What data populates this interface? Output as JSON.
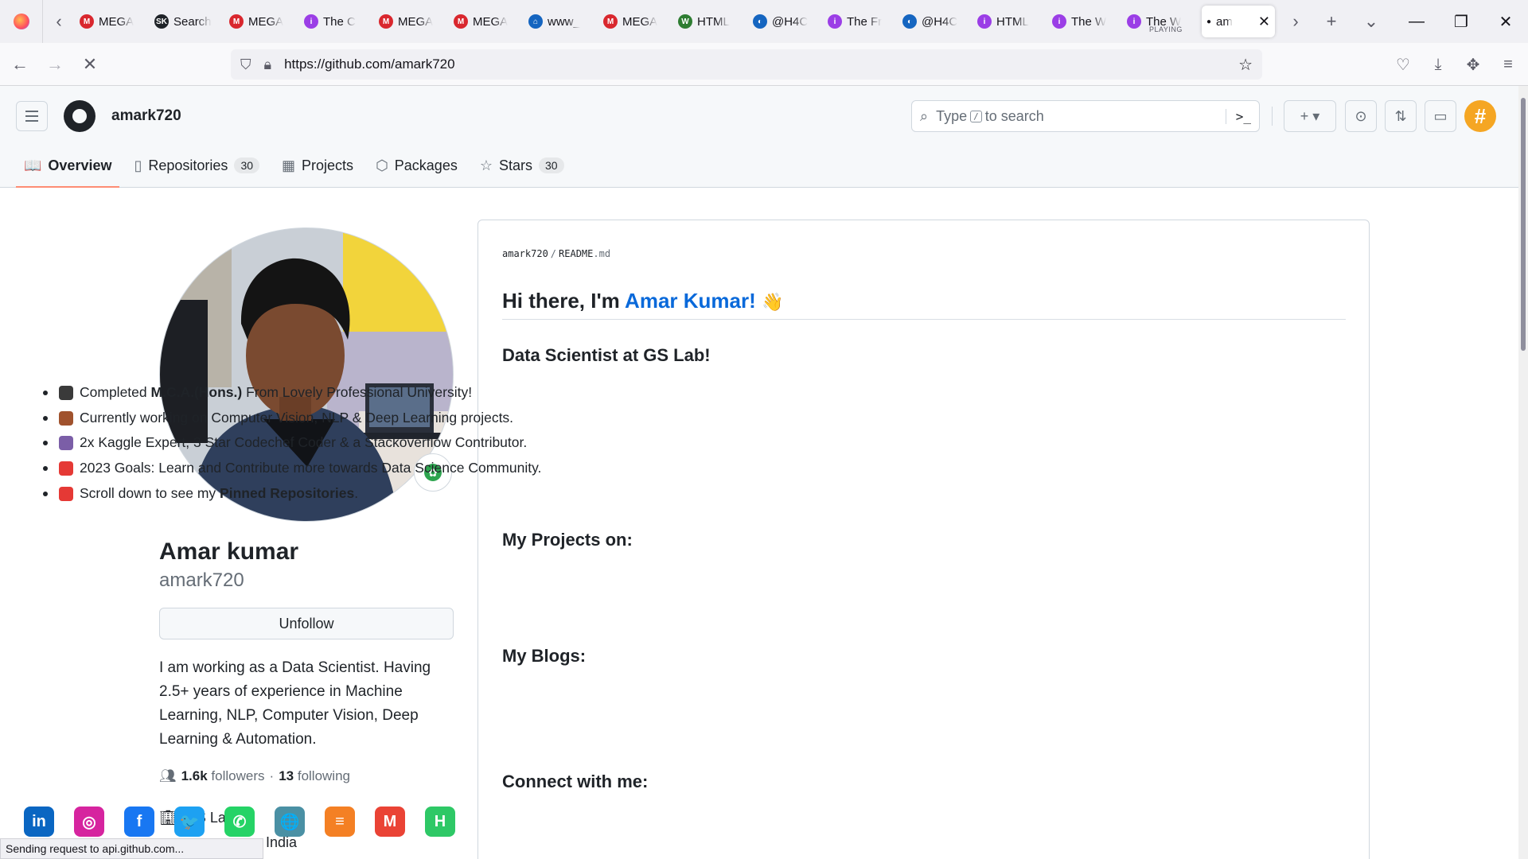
{
  "browser": {
    "tabs": [
      {
        "label": "MEGA",
        "color": "#d9272e",
        "glyph": "M"
      },
      {
        "label": "Search",
        "color": "#1f2328",
        "glyph": "SK"
      },
      {
        "label": "MEGA",
        "color": "#d9272e",
        "glyph": "M"
      },
      {
        "label": "The C",
        "color": "#9b3ee6",
        "glyph": "i"
      },
      {
        "label": "MEGA",
        "color": "#d9272e",
        "glyph": "M"
      },
      {
        "label": "MEGA",
        "color": "#d9272e",
        "glyph": "M"
      },
      {
        "label": "www_",
        "color": "#1565c0",
        "glyph": "⌂"
      },
      {
        "label": "MEGA",
        "color": "#d9272e",
        "glyph": "M"
      },
      {
        "label": "HTML",
        "color": "#2e7d32",
        "glyph": "W"
      },
      {
        "label": "@H4C",
        "color": "#1565c0",
        "glyph": "◐"
      },
      {
        "label": "The Fr",
        "color": "#9b3ee6",
        "glyph": "i"
      },
      {
        "label": "@H4C",
        "color": "#1565c0",
        "glyph": "◐"
      },
      {
        "label": "HTML",
        "color": "#9b3ee6",
        "glyph": "i"
      },
      {
        "label": "The W",
        "color": "#9b3ee6",
        "glyph": "i"
      }
    ],
    "playing_tab": {
      "label": "The W",
      "sub": "PLAYING"
    },
    "active_tab": {
      "label": "am"
    },
    "url": "https://github.com/amark720",
    "status": "Sending request to api.github.com..."
  },
  "header": {
    "username": "amark720",
    "search_before": "Type",
    "search_key": "/",
    "search_after": "to search",
    "command_glyph": ">_"
  },
  "profile_tabs": [
    {
      "label": "Overview",
      "icon": "book-icon",
      "glyph": "📖",
      "count": ""
    },
    {
      "label": "Repositories",
      "icon": "repo-icon",
      "glyph": "▯",
      "count": "30"
    },
    {
      "label": "Projects",
      "icon": "table-icon",
      "glyph": "▦",
      "count": ""
    },
    {
      "label": "Packages",
      "icon": "package-icon",
      "glyph": "⬡",
      "count": ""
    },
    {
      "label": "Stars",
      "icon": "star-icon",
      "glyph": "☆",
      "count": "30"
    }
  ],
  "profile": {
    "full_name": "Amar kumar",
    "login": "amark720",
    "unfollow_label": "Unfollow",
    "bio": "I am working as a Data Scientist. Having 2.5+ years of experience in Machine Learning, NLP, Computer Vision, Deep Learning & Automation.",
    "followers_count": "1.6k",
    "followers_label": "followers",
    "separator": "·",
    "following_count": "13",
    "following_label": "following",
    "company": "GS Lab",
    "location": "India"
  },
  "readme": {
    "owner": "amark720",
    "file": "README",
    "ext": ".md",
    "greeting": "Hi there, I'm",
    "name": "Amar Kumar!",
    "wave": "👋",
    "subtitle": "Data Scientist at GS Lab!",
    "bullets": [
      {
        "color": "#3a3a3a",
        "pre": "Completed ",
        "bold": "M.C.A.(Hons.)",
        "post": " From Lovely Professional University!"
      },
      {
        "color": "#a0522d",
        "pre": "Currently working on Computer Vision, NLP & Deep Learning projects.",
        "bold": "",
        "post": ""
      },
      {
        "color": "#7b5ea7",
        "pre": "2x Kaggle Expert, 3 Star Codechef Coder & a Stackoverflow Contributor.",
        "bold": "",
        "post": ""
      },
      {
        "color": "#e53935",
        "pre": "2023 Goals: Learn and Contribute more towards Data Science Community.",
        "bold": "",
        "post": ""
      },
      {
        "color": "#e53935",
        "pre": "Scroll down to see my ",
        "bold": "Pinned Repositories",
        "post": "."
      }
    ],
    "projects_heading": "My Projects on:",
    "blogs_heading": "My Blogs:",
    "connect_heading": "Connect with me:",
    "social": [
      {
        "name": "linkedin-icon",
        "label": "in",
        "color": "#0a66c2"
      },
      {
        "name": "instagram-icon",
        "label": "◎",
        "color": "#d6249f"
      },
      {
        "name": "facebook-icon",
        "label": "f",
        "color": "#1877f2"
      },
      {
        "name": "twitter-icon",
        "label": "🐦",
        "color": "#1da1f2"
      },
      {
        "name": "whatsapp-icon",
        "label": "✆",
        "color": "#25d366"
      },
      {
        "name": "website-icon",
        "label": "🌐",
        "color": "#4a90a4"
      },
      {
        "name": "stackoverflow-icon",
        "label": "≡",
        "color": "#f48024"
      },
      {
        "name": "gmail-icon",
        "label": "M",
        "color": "#ea4335"
      },
      {
        "name": "hackerrank-icon",
        "label": "H",
        "color": "#2ec866"
      }
    ]
  }
}
